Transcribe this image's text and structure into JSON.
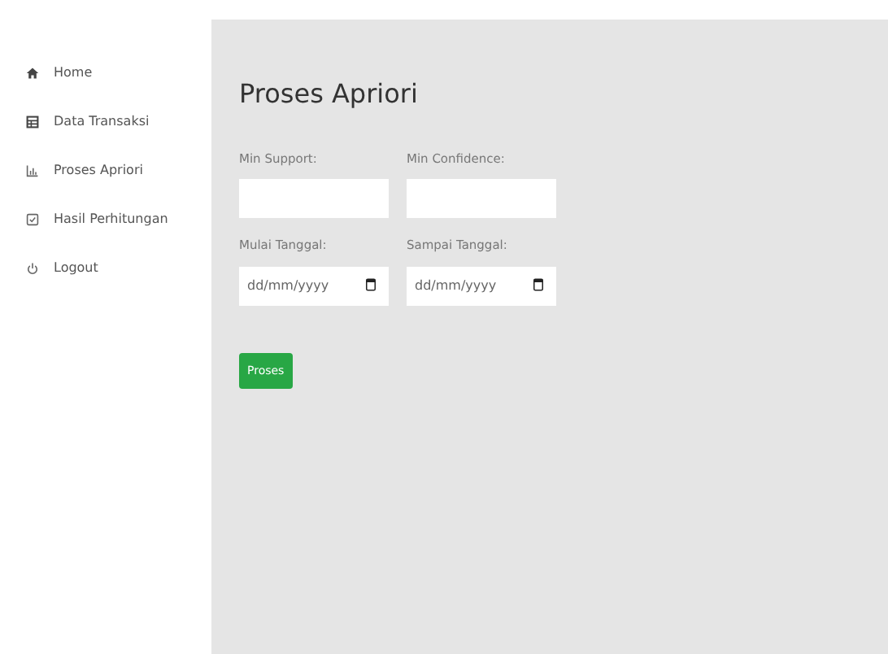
{
  "sidebar": {
    "items": [
      {
        "label": "Home"
      },
      {
        "label": "Data Transaksi"
      },
      {
        "label": "Proses Apriori"
      },
      {
        "label": "Hasil Perhitungan"
      },
      {
        "label": "Logout"
      }
    ]
  },
  "main": {
    "title": "Proses Apriori",
    "fields": [
      {
        "label": "Min Support:",
        "kind": "text"
      },
      {
        "label": "Min Confidence:",
        "kind": "text"
      },
      {
        "label": "Mulai Tanggal:",
        "kind": "date",
        "placeholder": "dd/mm/yyyy"
      },
      {
        "label": "Sampai Tanggal:",
        "kind": "date",
        "placeholder": "dd/mm/yyyy"
      }
    ],
    "button": "Proses"
  }
}
